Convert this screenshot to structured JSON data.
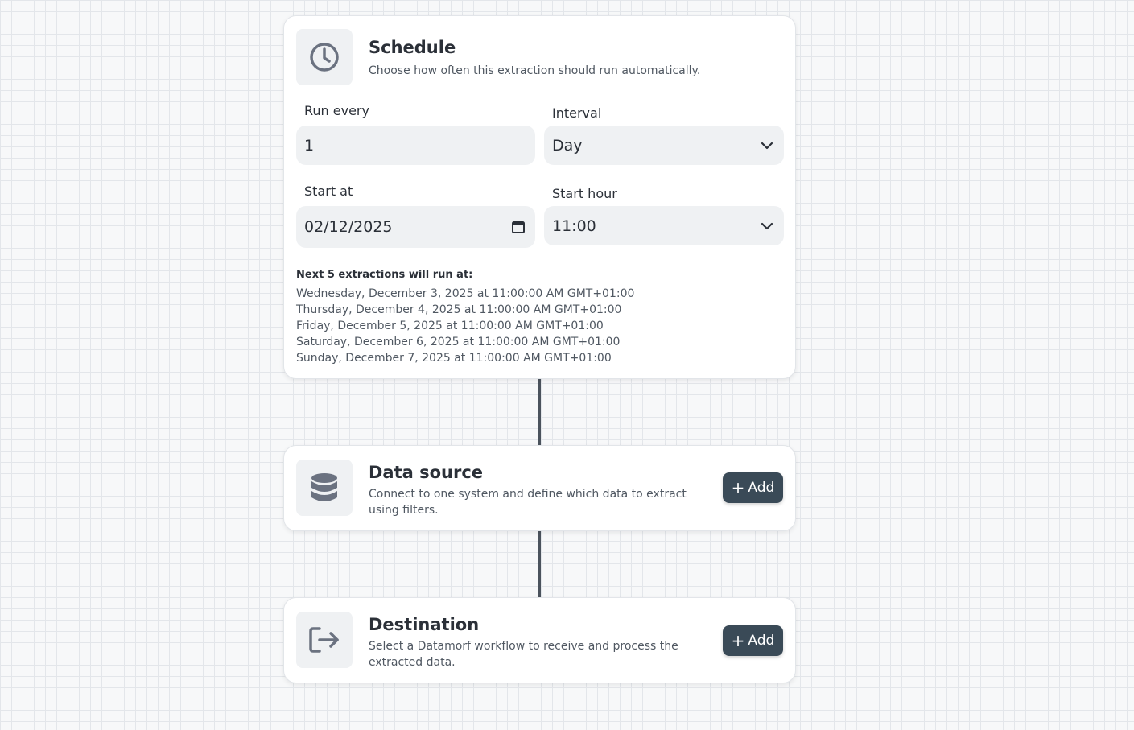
{
  "schedule": {
    "title": "Schedule",
    "description": "Choose how often this extraction should run automatically.",
    "icon": "clock-icon",
    "run_every_label": "Run every",
    "run_every_value": "1",
    "interval_label": "Interval",
    "interval_value": "Day",
    "start_at_label": "Start at",
    "start_at_value": "02/12/2025",
    "start_hour_label": "Start hour",
    "start_hour_value": "11:00",
    "next_title": "Next 5 extractions will run at:",
    "next_runs": [
      "Wednesday, December 3, 2025 at 11:00:00 AM GMT+01:00",
      "Thursday, December 4, 2025 at 11:00:00 AM GMT+01:00",
      "Friday, December 5, 2025 at 11:00:00 AM GMT+01:00",
      "Saturday, December 6, 2025 at 11:00:00 AM GMT+01:00",
      "Sunday, December 7, 2025 at 11:00:00 AM GMT+01:00"
    ]
  },
  "data_source": {
    "title": "Data source",
    "description": "Connect to one system and define which data to extract using filters.",
    "icon": "database-icon",
    "add_label": "Add"
  },
  "destination": {
    "title": "Destination",
    "description": "Select a Datamorf workflow to receive and process the extracted data.",
    "icon": "exit-arrow-icon",
    "add_label": "Add"
  },
  "colors": {
    "button_bg": "#3a4a57",
    "icon_color": "#6b7280",
    "connector": "#4b535d"
  }
}
